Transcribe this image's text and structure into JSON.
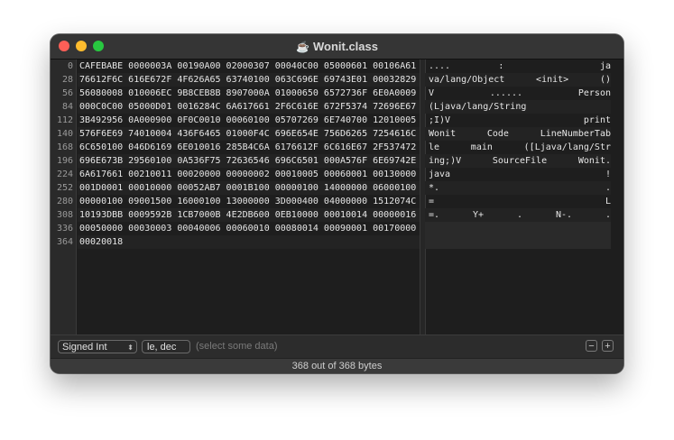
{
  "window": {
    "title": "Wonit.class",
    "title_icon": "coffee-cup-icon"
  },
  "offsets": [
    "0",
    "28",
    "56",
    "84",
    "112",
    "140",
    "168",
    "196",
    "224",
    "252",
    "280",
    "308",
    "336",
    "364"
  ],
  "hex_rows": [
    "CAFEBABE 0000003A 00190A00 02000307 00040C00 05000601 00106A61",
    "76612F6C 616E672F 4F626A65 63740100 063C696E 69743E01 00032829",
    "56080008 010006EC 9B8CEB8B 8907000A 01000650 6572736F 6E0A0009",
    "000C0C00 05000D01 0016284C 6A617661 2F6C616E 672F5374 72696E67",
    "3B492956 0A000900 0F0C0010 00060100 05707269 6E740700 12010005",
    "576F6E69 74010004 436F6465 01000F4C 696E654E 756D6265 7254616C",
    "6C650100 046D6169 6E010016 285B4C6A 6176612F 6C616E67 2F537472",
    "696E673B 29560100 0A536F75 72636546 696C6501 000A576F 6E69742E",
    "6A617661 00210011 00020000 00000002 00010005 00060001 00130000",
    "001D0001 00010000 00052AB7 0001B100 00000100 14000000 06000100",
    "00000100 09001500 16000100 13000000 3D000400 04000000 1512074C",
    "10193DBB 0009592B 1CB7000B 4E2DB600 0EB10000 00010014 00000016",
    "00050000 00030003 00040006 00060010 00080014 00090001 00170000",
    "00020018"
  ],
  "ascii_rows": [
    ".... :  ja",
    "va/lang/Object <init> ()",
    "V ...... Person",
    "(Ljava/lang/String",
    ";I)V print",
    "Wonit Code LineNumberTab",
    "le main ([Ljava/lang/Str",
    "ing;)V SourceFile Wonit.",
    "java !",
    "*. .",
    "= L",
    "=. Y+ . N-. .",
    "",
    ""
  ],
  "bottom": {
    "type_select": "Signed Int",
    "format_select": "le, dec",
    "hint": "(select some data)",
    "minus_label": "−",
    "plus_label": "+"
  },
  "status": "368 out of 368 bytes"
}
